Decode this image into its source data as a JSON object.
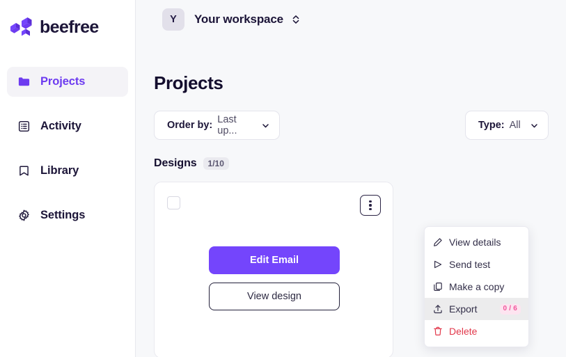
{
  "brand": {
    "name": "beefree",
    "logo_icon": "beefree-logo-icon",
    "primary_color": "#7445fc",
    "accent_color": "#6d3bf0"
  },
  "sidebar": {
    "items": [
      {
        "label": "Projects",
        "icon": "folder-icon",
        "active": true
      },
      {
        "label": "Activity",
        "icon": "list-icon",
        "active": false
      },
      {
        "label": "Library",
        "icon": "bookmark-icon",
        "active": false
      },
      {
        "label": "Settings",
        "icon": "gear-icon",
        "active": false
      }
    ]
  },
  "topbar": {
    "workspace_initial": "Y",
    "workspace_name": "Your workspace",
    "switcher_icon": "chevron-up-down-icon"
  },
  "main": {
    "page_title": "Projects",
    "order_by": {
      "label": "Order by:",
      "value": "Last up...",
      "icon": "chevron-down-icon"
    },
    "type_filter": {
      "label": "Type:",
      "value": "All",
      "icon": "chevron-down-icon"
    },
    "designs": {
      "label": "Designs",
      "count": "1/10"
    }
  },
  "card": {
    "checkbox_checked": false,
    "kebab_icon": "kebab-menu-icon",
    "primary_button": "Edit Email",
    "secondary_button": "View design"
  },
  "context_menu": {
    "items": [
      {
        "label": "View details",
        "icon": "pencil-icon",
        "badge": "",
        "danger": false,
        "hovered": false
      },
      {
        "label": "Send test",
        "icon": "send-icon",
        "badge": "",
        "danger": false,
        "hovered": false
      },
      {
        "label": "Make a copy",
        "icon": "copy-icon",
        "badge": "",
        "danger": false,
        "hovered": false
      },
      {
        "label": "Export",
        "icon": "upload-icon",
        "badge": "0 / 6",
        "danger": false,
        "hovered": true
      },
      {
        "label": "Delete",
        "icon": "trash-icon",
        "badge": "",
        "danger": true,
        "hovered": false
      }
    ],
    "badge_color": "#f0559b",
    "danger_color": "#e2384b"
  }
}
